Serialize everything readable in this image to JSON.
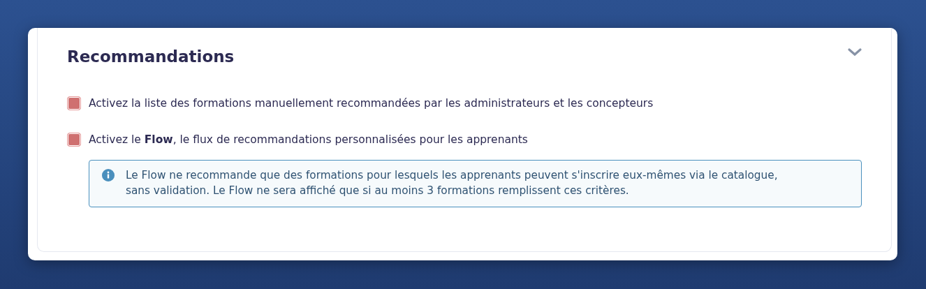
{
  "section": {
    "title": "Recommandations",
    "expanded": true
  },
  "options": [
    {
      "label": "Activez la liste des formations manuellement recommandées par les administrateurs et les concepteurs",
      "checked": false
    },
    {
      "label": "Activez le **Flow**, le flux de recommandations personnalisées pour les apprenants",
      "checked": false
    }
  ],
  "info": "Le Flow ne recommande que des formations pour lesquels les apprenants peuvent s'inscrire eux-mêmes via le catalogue, sans validation. Le Flow ne sera affiché que si au moins 3 formations remplissent ces critères."
}
